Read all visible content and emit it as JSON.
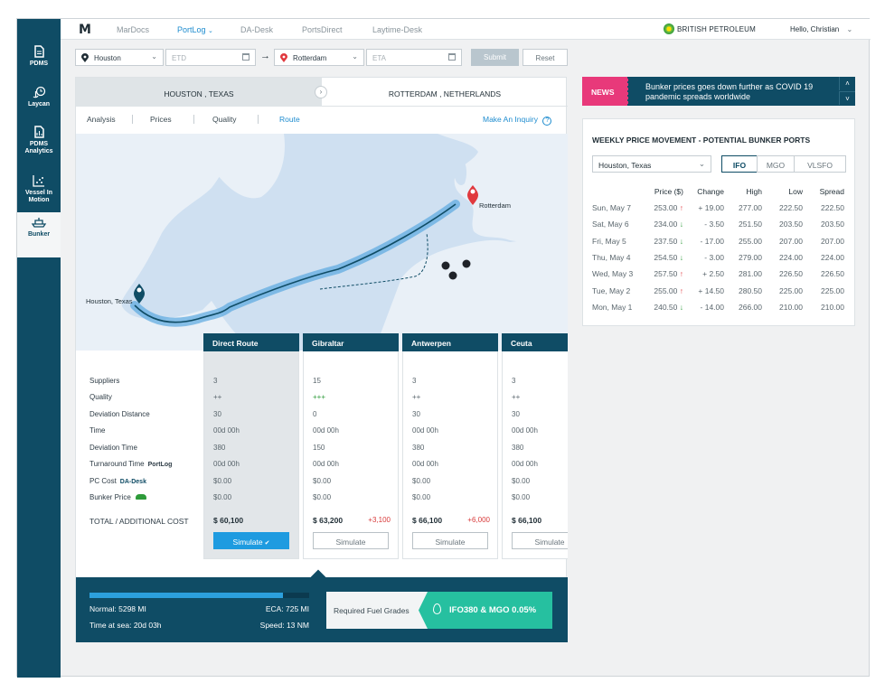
{
  "sidebar": {
    "items": [
      {
        "label": "PDMS",
        "icon": "document-icon"
      },
      {
        "label": "Laycan",
        "icon": "clock-anchor-icon"
      },
      {
        "label": "PDMS Analytics",
        "icon": "report-icon"
      },
      {
        "label": "Vessel In Motion",
        "icon": "scatter-chart-icon"
      },
      {
        "label": "Bunker",
        "icon": "ship-icon",
        "active": true
      }
    ]
  },
  "topbar": {
    "logo": "M",
    "nav": [
      "MarDocs",
      "PortLog",
      "DA-Desk",
      "PortsDirect",
      "Laytime-Desk"
    ],
    "active_nav": "PortLog",
    "company": "BRITISH PETROLEUM",
    "user": "Hello, Christian"
  },
  "search": {
    "origin": "Houston",
    "etd_placeholder": "ETD",
    "destination": "Rotterdam",
    "eta_placeholder": "ETA",
    "submit": "Submit",
    "reset": "Reset"
  },
  "route": {
    "origin": "HOUSTON , TEXAS",
    "destination": "ROTTERDAM , NETHERLANDS",
    "tabs": [
      "Analysis",
      "Prices",
      "Quality",
      "Route"
    ],
    "active_tab": "Route",
    "inquiry": "Make An Inquiry"
  },
  "map": {
    "origin_label": "Houston, Texas",
    "destination_label": "Rotterdam"
  },
  "table": {
    "rows": [
      "Suppliers",
      "Quality",
      "Deviation Distance",
      "Time",
      "Deviation Time",
      "Turnaround Time",
      "PC Cost",
      "Bunker Price"
    ],
    "row_badges": {
      "Turnaround Time": "PortLog",
      "PC Cost": "DA-Desk"
    },
    "total_label": "TOTAL / ADDITIONAL COST",
    "simulate": "Simulate",
    "columns": [
      {
        "name": "Direct Route",
        "values": [
          "3",
          "++",
          "30",
          "00d 00h",
          "380",
          "00d 00h",
          "$0.00",
          "$0.00"
        ],
        "total": "$ 60,100",
        "extra": "",
        "selected": true
      },
      {
        "name": "Gibraltar",
        "values": [
          "15",
          "+++",
          "0",
          "00d 00h",
          "150",
          "00d 00h",
          "$0.00",
          "$0.00"
        ],
        "total": "$ 63,200",
        "extra": "+3,100"
      },
      {
        "name": "Antwerpen",
        "values": [
          "3",
          "++",
          "30",
          "00d 00h",
          "380",
          "00d 00h",
          "$0.00",
          "$0.00"
        ],
        "total": "$ 66,100",
        "extra": "+6,000"
      },
      {
        "name": "Ceuta",
        "values": [
          "3",
          "++",
          "30",
          "00d 00h",
          "380",
          "00d 00h",
          "$0.00",
          "$0.00"
        ],
        "total": "$ 66,100",
        "extra": ""
      }
    ]
  },
  "footer": {
    "normal": "Normal: 5298 MI",
    "eca": "ECA: 725 MI",
    "time_at_sea": "Time at sea: 20d 03h",
    "speed": "Speed: 13 NM",
    "eca_fraction": 0.12,
    "fuel_label": "Required Fuel Grades",
    "fuel_value": "IFO380 & MGO 0.05%"
  },
  "news": {
    "tag": "NEWS",
    "text": "Bunker prices goes down further as COVID 19 pandemic spreads worldwide"
  },
  "weekly": {
    "title": "WEEKLY PRICE MOVEMENT - POTENTIAL BUNKER PORTS",
    "port": "Houston, Texas",
    "grades": [
      "IFO",
      "MGO",
      "VLSFO"
    ],
    "active_grade": "IFO",
    "headers": [
      "Price ($)",
      "Change",
      "High",
      "Low",
      "Spread"
    ],
    "rows": [
      {
        "date": "Sun, May 7",
        "price": "253.00",
        "dir": "up",
        "change": "+ 19.00",
        "high": "277.00",
        "low": "222.50",
        "spread": "222.50"
      },
      {
        "date": "Sat, May 6",
        "price": "234.00",
        "dir": "down",
        "change": "- 3.50",
        "high": "251.50",
        "low": "203.50",
        "spread": "203.50"
      },
      {
        "date": "Fri, May 5",
        "price": "237.50",
        "dir": "down",
        "change": "- 17.00",
        "high": "255.00",
        "low": "207.00",
        "spread": "207.00"
      },
      {
        "date": "Thu, May 4",
        "price": "254.50",
        "dir": "down",
        "change": "- 3.00",
        "high": "279.00",
        "low": "224.00",
        "spread": "224.00"
      },
      {
        "date": "Wed, May 3",
        "price": "257.50",
        "dir": "up",
        "change": "+ 2.50",
        "high": "281.00",
        "low": "226.50",
        "spread": "226.50"
      },
      {
        "date": "Tue, May 2",
        "price": "255.00",
        "dir": "up",
        "change": "+ 14.50",
        "high": "280.50",
        "low": "225.00",
        "spread": "225.00"
      },
      {
        "date": "Mon, May 1",
        "price": "240.50",
        "dir": "down",
        "change": "- 14.00",
        "high": "266.00",
        "low": "210.00",
        "spread": "210.00"
      }
    ]
  }
}
